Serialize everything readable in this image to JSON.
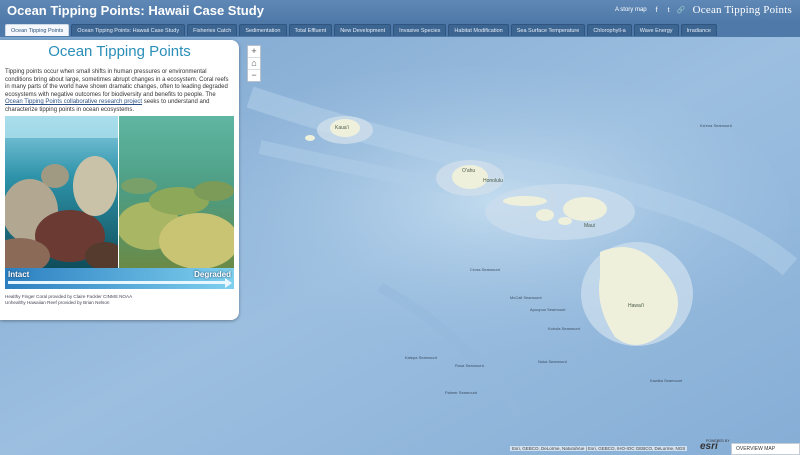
{
  "header": {
    "title": "Ocean Tipping Points: Hawaii Case Study",
    "story_link": "A story map",
    "social": [
      "f",
      "t",
      "🔗"
    ],
    "brand": "Ocean Tipping Points"
  },
  "tabs": [
    {
      "label": "Ocean Tipping Points",
      "active": true
    },
    {
      "label": "Ocean Tipping Points: Hawaii Case Study"
    },
    {
      "label": "Fisheries Catch"
    },
    {
      "label": "Sedimentation"
    },
    {
      "label": "Total Effluent"
    },
    {
      "label": "New Development"
    },
    {
      "label": "Invasive Species"
    },
    {
      "label": "Habitat Modification"
    },
    {
      "label": "Sea Surface Temperature"
    },
    {
      "label": "Chlorophyll-a"
    },
    {
      "label": "Wave Energy"
    },
    {
      "label": "Irradiance"
    }
  ],
  "panel": {
    "title": "Ocean Tipping Points",
    "body_before_link": "Tipping points occur when small shifts in human pressures or environmental conditions bring about large, sometimes abrupt changes in a ecosystem. Coral reefs in many parts of the world have shown dramatic changes, often to leading degraded ecosystems with negative outcomes for biodiversity and benefits to people. The ",
    "link_text": "Ocean Tipping Points collaborative research project",
    "body_after_link": " seeks to understand and characterize tipping points in ocean ecosystems.",
    "bar_left": "Intact",
    "bar_right": "Degraded",
    "credit_1": "Healthy Finger Coral provided by Claire Fackler CINMS NOAA",
    "credit_2": "Unhealthy Hawaiian Reef provided by Brian Nelson"
  },
  "zoom": {
    "in": "+",
    "home": "⌂",
    "out": "−"
  },
  "map": {
    "islands": [
      "Kaua'i",
      "O'ahu",
      "Honolulu",
      "Maui",
      "Hawai'i"
    ],
    "seamounts": [
      "Cross Seamount",
      "McCall Seamount",
      "Apuupuu Seamount",
      "Kohola Seamount",
      "Kalepa Seamount",
      "Rosa Seamount",
      "Nuka Seamount",
      "Kawika Seamount",
      "Palmer Seamount",
      "Ka'ena Seamount"
    ],
    "attribution": "Esri, GEBCO, DeLorme, NaturalVue  |  Esri, GEBCO, IHO-IOC GEBCO, DeLorme, NGS",
    "esri_powered": "POWERED BY",
    "esri": "esri",
    "overview": "OVERVIEW MAP"
  }
}
